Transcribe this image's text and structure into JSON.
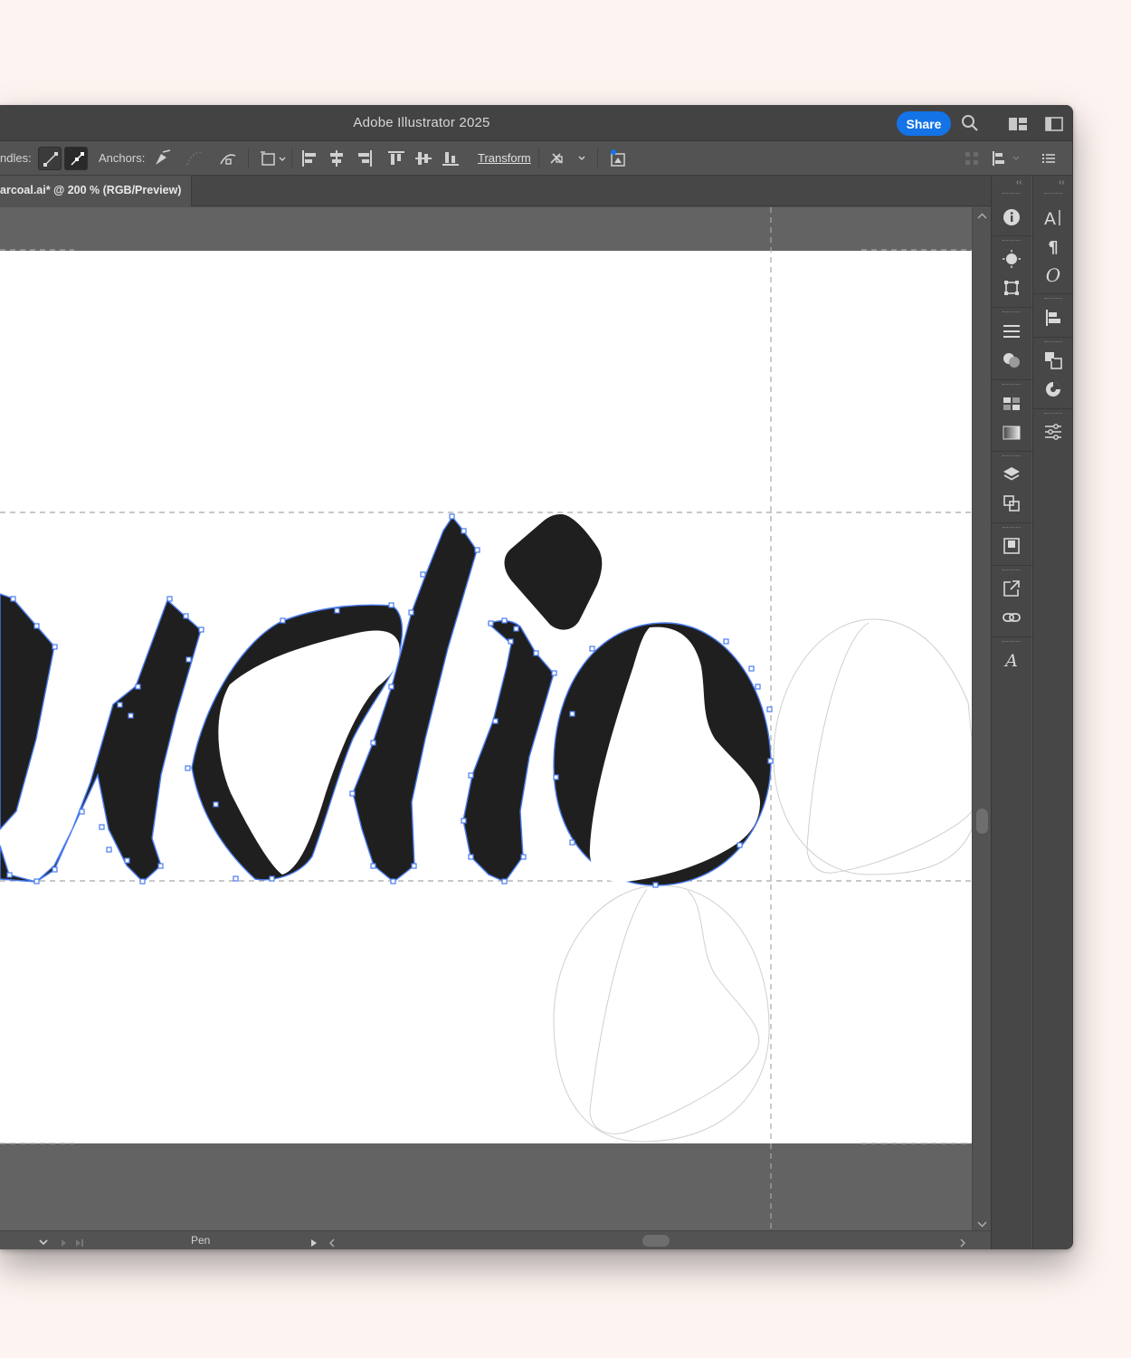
{
  "app": {
    "title": "Adobe Illustrator 2025",
    "share_label": "Share"
  },
  "control_bar": {
    "handles_label": "ndles:",
    "anchors_label": "Anchors:",
    "transform_label": "Transform"
  },
  "document_tab": {
    "label": "arcoal.ai* @ 200 % (RGB/Preview)"
  },
  "status_bar": {
    "current_tool": "Pen"
  },
  "colors": {
    "selection": "#4a7cf0",
    "fill": "#1f1f1f",
    "accent": "#1473e6"
  },
  "icons": {
    "title_bar": [
      "search-icon",
      "arrange-documents-icon",
      "workspace-icon"
    ],
    "panels_col1": [
      "info-icon",
      "appearance-icon",
      "transform-icon",
      "stroke-icon",
      "transparency-icon",
      "swatches-icon",
      "gradient-icon",
      "layers-icon",
      "pathfinder-icon",
      "artboards-icon",
      "export-icon",
      "links-icon",
      "glyphs-icon"
    ],
    "panels_col2": [
      "character-icon",
      "paragraph-icon",
      "opentype-icon",
      "align-icon",
      "pathfinder-icon",
      "color-guide-icon",
      "properties-icon"
    ]
  }
}
